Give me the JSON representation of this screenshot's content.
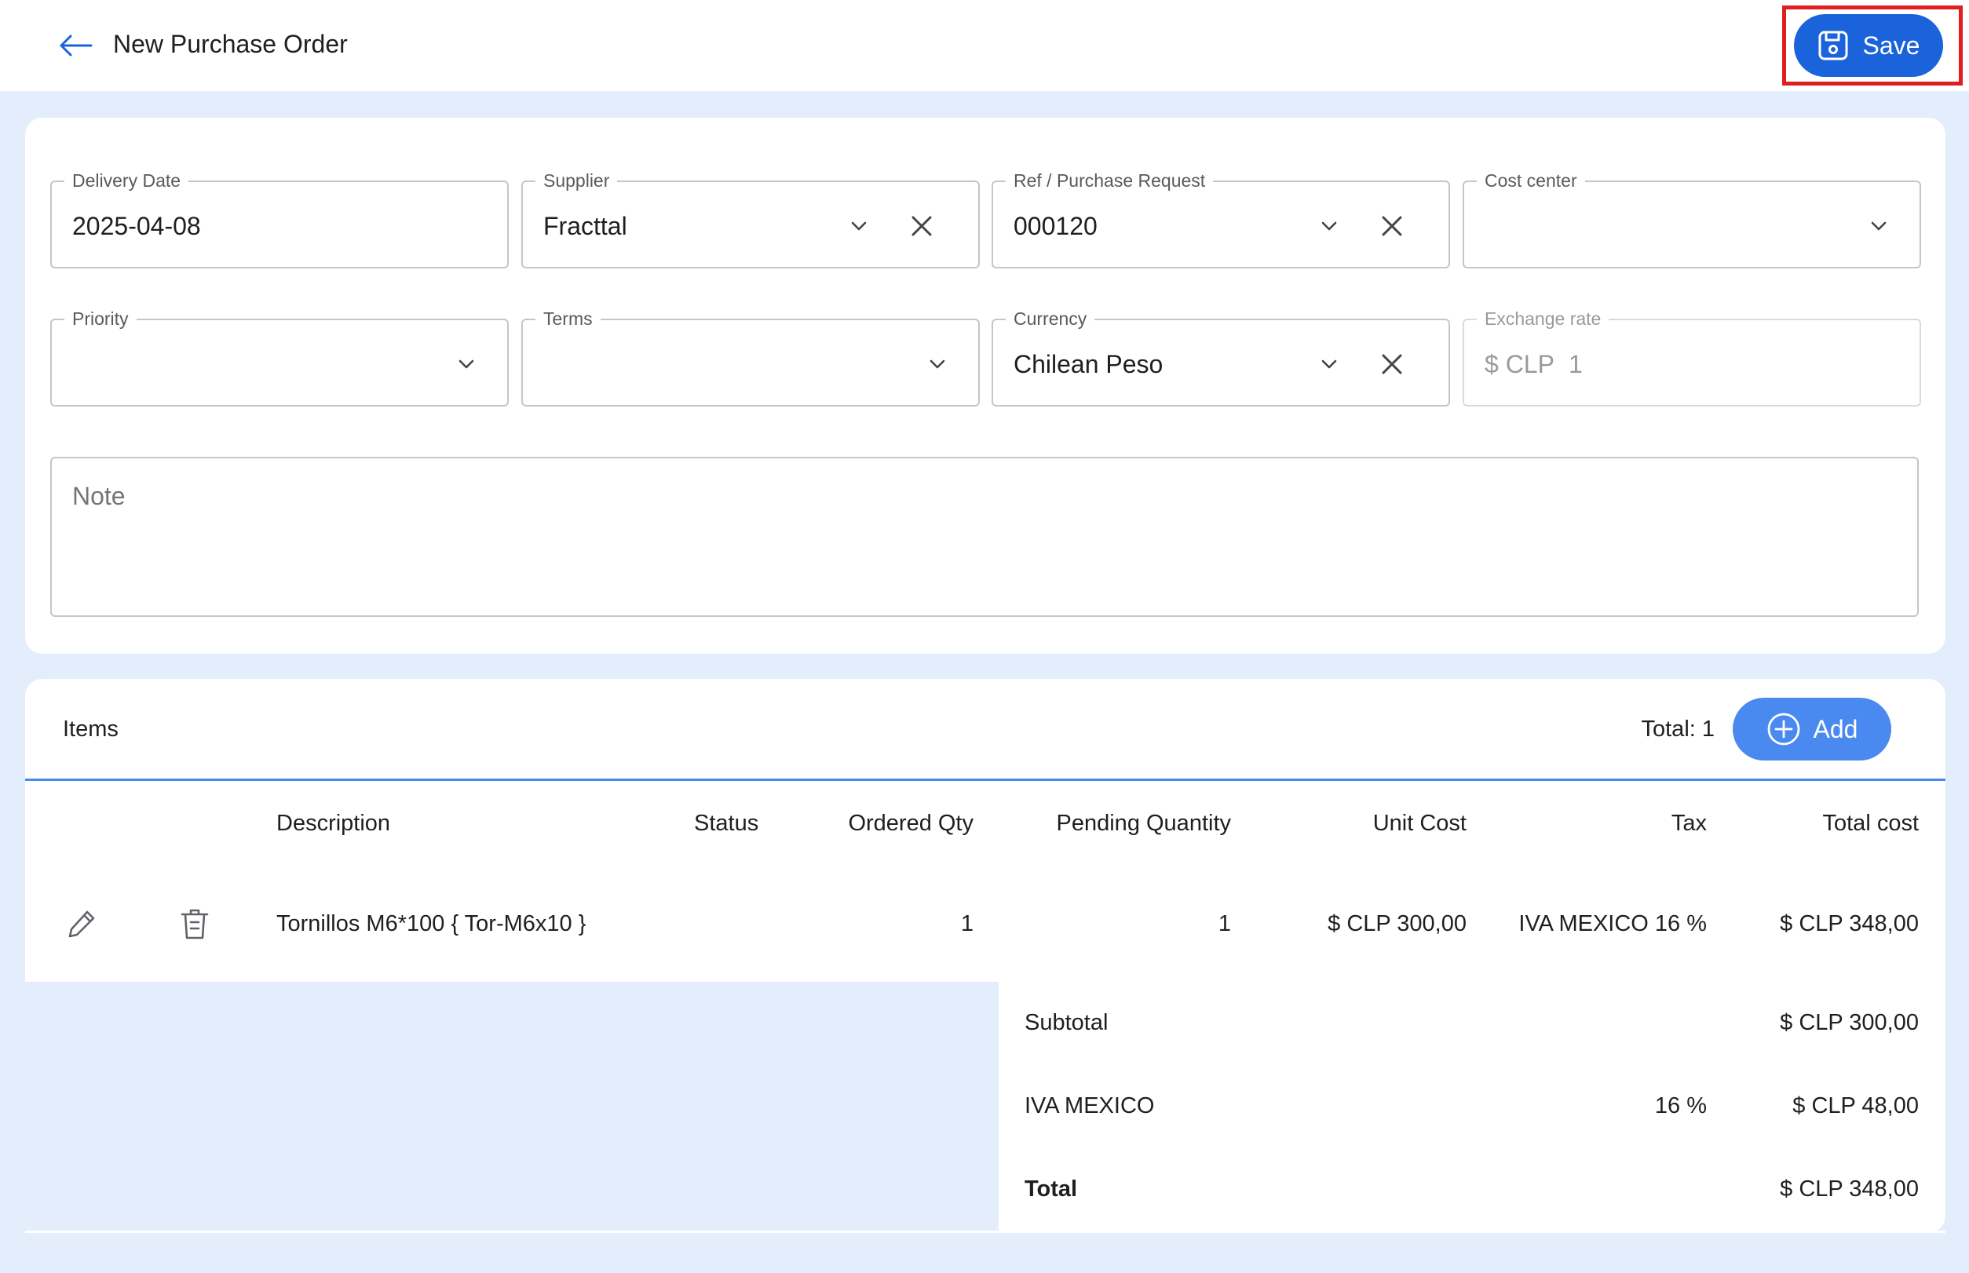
{
  "header": {
    "title": "New Purchase Order",
    "save_label": "Save"
  },
  "form": {
    "delivery_date": {
      "label": "Delivery Date",
      "value": "2025-04-08"
    },
    "supplier": {
      "label": "Supplier",
      "value": "Fracttal"
    },
    "ref_purchase_request": {
      "label": "Ref / Purchase Request",
      "value": "000120"
    },
    "cost_center": {
      "label": "Cost center",
      "value": ""
    },
    "priority": {
      "label": "Priority",
      "value": ""
    },
    "terms": {
      "label": "Terms",
      "value": ""
    },
    "currency": {
      "label": "Currency",
      "value": "Chilean Peso"
    },
    "exchange_rate": {
      "label": "Exchange rate",
      "prefix": "$ CLP",
      "value": "1"
    },
    "note": {
      "placeholder": "Note"
    }
  },
  "items": {
    "title": "Items",
    "total_label": "Total: 1",
    "add_label": "Add",
    "columns": [
      "Description",
      "Status",
      "Ordered Qty",
      "Pending Quantity",
      "Unit Cost",
      "Tax",
      "Total cost"
    ],
    "rows": [
      {
        "description": "Tornillos M6*100 { Tor-M6x10 }",
        "status": "",
        "ordered_qty": "1",
        "pending_qty": "1",
        "unit_cost": "$ CLP 300,00",
        "tax": "IVA MEXICO 16 %",
        "total_cost": "$ CLP 348,00"
      }
    ]
  },
  "summary": {
    "subtotal_label": "Subtotal",
    "subtotal_value": "$ CLP 300,00",
    "tax_label": "IVA MEXICO",
    "tax_pct": "16 %",
    "tax_value": "$ CLP 48,00",
    "total_label": "Total",
    "total_value": "$ CLP 348,00"
  },
  "colors": {
    "primary": "#1a63db",
    "accent": "#4a8af0",
    "background": "#e4edfc",
    "highlight": "#e01e1e"
  }
}
